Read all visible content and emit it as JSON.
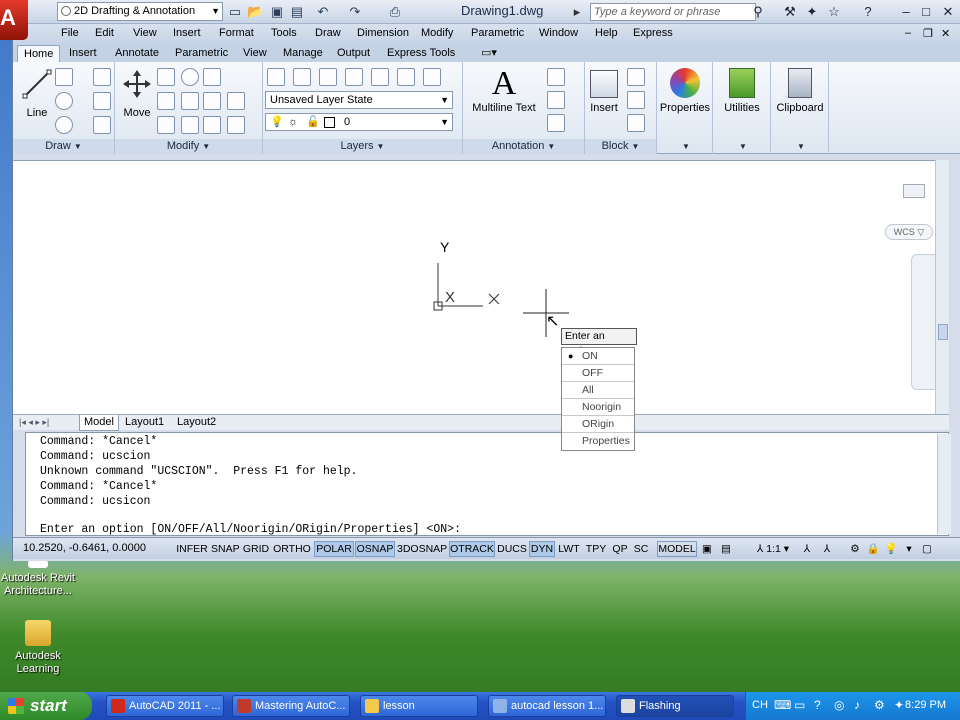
{
  "app": {
    "logo_letter": "A",
    "workspace": "2D Drafting & Annotation",
    "doc_title": "Drawing1.dwg",
    "search_placeholder": "Type a keyword or phrase"
  },
  "menubar": [
    "File",
    "Edit",
    "View",
    "Insert",
    "Format",
    "Tools",
    "Draw",
    "Dimension",
    "Modify",
    "Parametric",
    "Window",
    "Help",
    "Express"
  ],
  "ribbon_tabs": [
    "Home",
    "Insert",
    "Annotate",
    "Parametric",
    "View",
    "Manage",
    "Output",
    "Express Tools"
  ],
  "ribbon": {
    "draw": {
      "title": "Draw",
      "line_label": "Line"
    },
    "modify": {
      "title": "Modify",
      "move_label": "Move"
    },
    "layers": {
      "title": "Layers",
      "layer_state": "Unsaved Layer State",
      "current_layer": "0"
    },
    "annotation": {
      "title": "Annotation",
      "mtext_letter": "A",
      "mtext_label": "Multiline Text"
    },
    "block": {
      "title": "Block",
      "insert_label": "Insert"
    },
    "properties_label": "Properties",
    "utilities_label": "Utilities",
    "clipboard_label": "Clipboard"
  },
  "ucs": {
    "y_label": "Y",
    "x_label": "X"
  },
  "viewcube": {
    "wcs_label": "WCS"
  },
  "dynamic_input": {
    "tooltip": "Enter an option",
    "options": [
      "ON",
      "OFF",
      "All",
      "Noorigin",
      "ORigin",
      "Properties"
    ],
    "selected": "ON"
  },
  "layout_tabs": [
    "Model",
    "Layout1",
    "Layout2"
  ],
  "command_history": [
    "Command: *Cancel*",
    "Command: ucscion",
    "Unknown command \"UCSCION\".  Press F1 for help.",
    "Command: *Cancel*",
    "Command: ucsicon"
  ],
  "command_prompt": "Enter an option [ON/OFF/All/Noorigin/ORigin/Properties] <ON>:",
  "status": {
    "coords": "10.2520, -0.6461, 0.0000",
    "toggles": [
      {
        "label": "INFER",
        "on": false
      },
      {
        "label": "SNAP",
        "on": false
      },
      {
        "label": "GRID",
        "on": false
      },
      {
        "label": "ORTHO",
        "on": false
      },
      {
        "label": "POLAR",
        "on": true
      },
      {
        "label": "OSNAP",
        "on": true
      },
      {
        "label": "3DOSNAP",
        "on": false
      },
      {
        "label": "OTRACK",
        "on": true
      },
      {
        "label": "DUCS",
        "on": false
      },
      {
        "label": "DYN",
        "on": true
      },
      {
        "label": "LWT",
        "on": false
      },
      {
        "label": "TPY",
        "on": false
      },
      {
        "label": "QP",
        "on": false
      },
      {
        "label": "SC",
        "on": false
      }
    ],
    "model_label": "MODEL",
    "scale_label": "1:1"
  },
  "desktop_icons": [
    {
      "label": "Autodesk Revit Architecture..."
    },
    {
      "label": "Autodesk Learning"
    }
  ],
  "taskbar": {
    "start_label": "start",
    "tasks": [
      "AutoCAD 2011 - ...",
      "Mastering AutoC...",
      "lesson",
      "autocad lesson 1...",
      "Flashing"
    ],
    "lang": "CH",
    "clock": "8:29 PM"
  },
  "colors": {
    "accent_blue": "#aecae8",
    "logo_red": "#d0281a",
    "start_green": "#3c9a36"
  }
}
